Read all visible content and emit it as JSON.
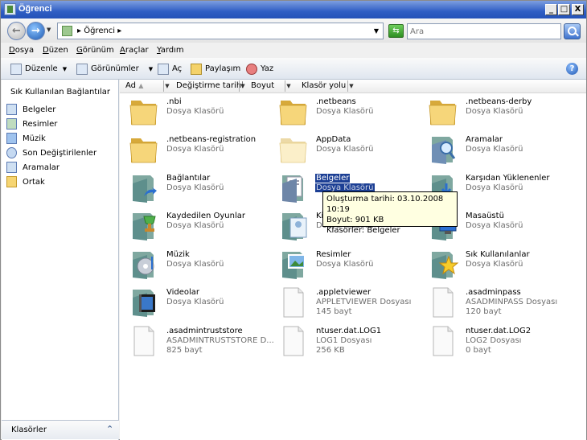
{
  "window": {
    "title": "Öğrenci",
    "minimize": "_",
    "maximize": "□",
    "close": "X"
  },
  "address": {
    "breadcrumb": "Öğrenci",
    "search_placeholder": "Ara"
  },
  "menu": [
    "Dosya",
    "Düzen",
    "Görünüm",
    "Araçlar",
    "Yardım"
  ],
  "toolbar": {
    "organize": "Düzenle",
    "views": "Görünümler",
    "open": "Aç",
    "share": "Paylaşım",
    "burn": "Yaz"
  },
  "sidebar": {
    "header": "Sık Kullanılan Bağlantılar",
    "items": [
      {
        "label": "Belgeler",
        "icon": "documents-icon"
      },
      {
        "label": "Resimler",
        "icon": "pictures-icon"
      },
      {
        "label": "Müzik",
        "icon": "music-icon"
      },
      {
        "label": "Son Değiştirilenler",
        "icon": "recent-icon"
      },
      {
        "label": "Aramalar",
        "icon": "searches-icon"
      },
      {
        "label": "Ortak",
        "icon": "folder-icon"
      }
    ],
    "folders_label": "Klasörler"
  },
  "columns": [
    "Ad",
    "Değiştirme tarihi",
    "Boyut",
    "Klasör yolu"
  ],
  "files": [
    {
      "name": ".nbi",
      "type": "Dosya Klasörü",
      "icon": "folder"
    },
    {
      "name": ".netbeans",
      "type": "Dosya Klasörü",
      "icon": "folder"
    },
    {
      "name": ".netbeans-derby",
      "type": "Dosya Klasörü",
      "icon": "folder"
    },
    {
      "name": ".netbeans-registration",
      "type": "Dosya Klasörü",
      "icon": "folder"
    },
    {
      "name": "AppData",
      "type": "Dosya Klasörü",
      "icon": "folder-faded"
    },
    {
      "name": "Aramalar",
      "type": "Dosya Klasörü",
      "icon": "searches"
    },
    {
      "name": "Bağlantılar",
      "type": "Dosya Klasörü",
      "icon": "links"
    },
    {
      "name": "Belgeler",
      "type": "Dosya Klasörü",
      "icon": "documents",
      "selected": true
    },
    {
      "name": "Karşıdan Yüklenenler",
      "type": "Dosya Klasörü",
      "icon": "downloads"
    },
    {
      "name": "Kaydedilen Oyunlar",
      "type": "Dosya Klasörü",
      "icon": "games"
    },
    {
      "name": "Kişiler",
      "type": "Dosya Klasörü",
      "icon": "contacts"
    },
    {
      "name": "Masaüstü",
      "type": "Dosya Klasörü",
      "icon": "desktop"
    },
    {
      "name": "Müzik",
      "type": "Dosya Klasörü",
      "icon": "music"
    },
    {
      "name": "Resimler",
      "type": "Dosya Klasörü",
      "icon": "pictures"
    },
    {
      "name": "Sık Kullanılanlar",
      "type": "Dosya Klasörü",
      "icon": "favorites"
    },
    {
      "name": "Videolar",
      "type": "Dosya Klasörü",
      "icon": "videos"
    },
    {
      "name": ".appletviewer",
      "type": "APPLETVIEWER Dosyası",
      "size": "145 bayt",
      "icon": "file"
    },
    {
      "name": ".asadminpass",
      "type": "ASADMINPASS Dosyası",
      "size": "120 bayt",
      "icon": "file"
    },
    {
      "name": ".asadmintruststore",
      "type": "ASADMINTRUSTSTORE D...",
      "size": "825 bayt",
      "icon": "file"
    },
    {
      "name": "ntuser.dat.LOG1",
      "type": "LOG1 Dosyası",
      "size": "256 KB",
      "icon": "file"
    },
    {
      "name": "ntuser.dat.LOG2",
      "type": "LOG2 Dosyası",
      "size": "0 bayt",
      "icon": "file"
    }
  ],
  "tooltip": {
    "line1": "Oluşturma tarihi: 03.10.2008 10:19",
    "line2": "Boyut: 901 KB",
    "line3": "Klasörler: Belgeler"
  }
}
